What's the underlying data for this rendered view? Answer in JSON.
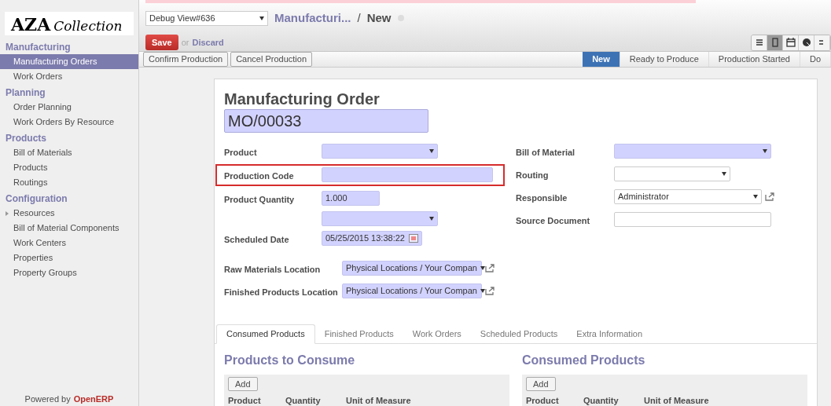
{
  "sidebar": {
    "logo": {
      "mark": "AZA",
      "script": "Collection"
    },
    "sections": [
      {
        "title": "Manufacturing",
        "items": [
          {
            "label": "Manufacturing Orders",
            "selected": true,
            "kind": "link"
          },
          {
            "label": "Work Orders",
            "selected": false,
            "kind": "link"
          }
        ]
      },
      {
        "title": "Planning",
        "items": [
          {
            "label": "Order Planning",
            "selected": false,
            "kind": "link"
          },
          {
            "label": "Work Orders By Resource",
            "selected": false,
            "kind": "link"
          }
        ]
      },
      {
        "title": "Products",
        "items": [
          {
            "label": "Bill of Materials",
            "selected": false,
            "kind": "link"
          },
          {
            "label": "Products",
            "selected": false,
            "kind": "link"
          },
          {
            "label": "Routings",
            "selected": false,
            "kind": "link"
          }
        ]
      },
      {
        "title": "Configuration",
        "items": [
          {
            "label": "Resources",
            "selected": false,
            "kind": "group"
          },
          {
            "label": "Bill of Material Components",
            "selected": false,
            "kind": "link"
          },
          {
            "label": "Work Centers",
            "selected": false,
            "kind": "link"
          },
          {
            "label": "Properties",
            "selected": false,
            "kind": "link"
          },
          {
            "label": "Property Groups",
            "selected": false,
            "kind": "link"
          }
        ]
      }
    ],
    "footer": {
      "text": "Powered by",
      "link": "OpenERP"
    }
  },
  "header": {
    "view_select": "Debug View#636",
    "breadcrumb": "Manufacturi...",
    "separator": "/",
    "current": "New",
    "save": "Save",
    "or": "or",
    "discard": "Discard",
    "views": [
      {
        "kind": "list",
        "selected": false
      },
      {
        "kind": "form",
        "selected": true
      },
      {
        "kind": "calendar",
        "selected": false
      },
      {
        "kind": "chart",
        "selected": false
      },
      {
        "kind": "more",
        "selected": false
      }
    ]
  },
  "actions": [
    "Confirm Production",
    "Cancel Production"
  ],
  "stages": [
    {
      "label": "New",
      "selected": true
    },
    {
      "label": "Ready to Produce",
      "selected": false
    },
    {
      "label": "Production Started",
      "selected": false
    },
    {
      "label": "Do",
      "selected": false
    }
  ],
  "form": {
    "title": "Manufacturing Order",
    "name": "MO/00033",
    "left_fields": [
      {
        "label": "Product",
        "kind": "select",
        "required": true,
        "highlighted": false
      },
      {
        "label": "Production Code",
        "kind": "input",
        "required": true,
        "highlighted": true
      },
      {
        "label": "Product Quantity",
        "kind": "input",
        "value": "1.000",
        "required": true,
        "highlighted": false
      },
      {
        "kind": "select",
        "required": true,
        "highlighted": false
      },
      {
        "label": "Scheduled Date",
        "kind": "date",
        "value": "05/25/2015 13:38:22",
        "required": true,
        "highlighted": false
      }
    ],
    "right_fields": [
      {
        "label": "Bill of Material",
        "kind": "select",
        "required": true,
        "link": false
      },
      {
        "label": "Routing",
        "kind": "select",
        "required": false,
        "link": false
      },
      {
        "label": "Responsible",
        "kind": "select",
        "value": "Administrator",
        "required": false,
        "link": true
      },
      {
        "label": "Source Document",
        "kind": "input",
        "required": false,
        "link": false
      }
    ],
    "locations": [
      {
        "label": "Raw Materials Location",
        "value": "Physical Locations / Your Compan"
      },
      {
        "label": "Finished Products Location",
        "value": "Physical Locations / Your Compan"
      }
    ],
    "tabs": [
      {
        "label": "Consumed Products",
        "selected": true
      },
      {
        "label": "Finished Products",
        "selected": false
      },
      {
        "label": "Work Orders",
        "selected": false
      },
      {
        "label": "Scheduled Products",
        "selected": false
      },
      {
        "label": "Extra Information",
        "selected": false
      }
    ],
    "panels": [
      {
        "title": "Products to Consume",
        "add": "Add",
        "columns": [
          "Product",
          "Quantity",
          "Unit of Measure"
        ]
      },
      {
        "title": "Consumed Products",
        "add": "Add",
        "columns": [
          "Product",
          "Quantity",
          "Unit of Measure"
        ]
      }
    ]
  }
}
